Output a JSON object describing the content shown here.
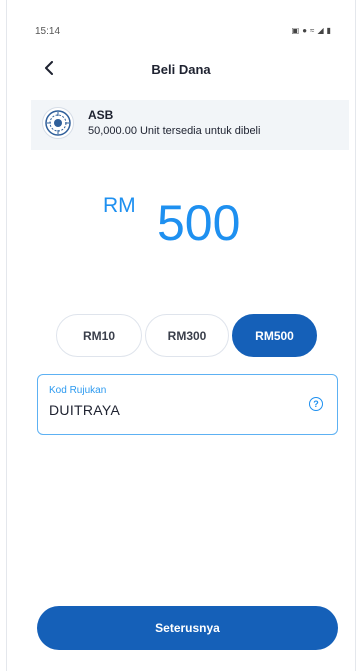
{
  "status_bar": {
    "time": "15:14"
  },
  "header": {
    "title": "Beli Dana"
  },
  "fund": {
    "name": "ASB",
    "units_text": "50,000.00 Unit tersedia untuk dibeli"
  },
  "amount": {
    "currency": "RM",
    "value": "500"
  },
  "presets": [
    {
      "label": "RM10",
      "selected": false
    },
    {
      "label": "RM300",
      "selected": false
    },
    {
      "label": "RM500",
      "selected": true
    }
  ],
  "referral": {
    "label": "Kod Rujukan",
    "value": "DUITRAYA"
  },
  "footer": {
    "next_label": "Seterusnya"
  },
  "colors": {
    "primary": "#1560b8",
    "accent": "#1e90f0"
  },
  "icons": {
    "back": "back-arrow-icon",
    "help": "help-icon",
    "fund_logo": "asb-logo-icon"
  }
}
